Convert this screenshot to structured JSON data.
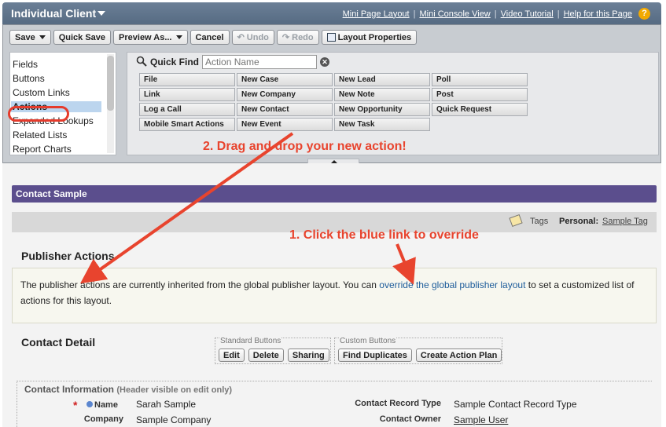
{
  "header": {
    "title": "Individual Client",
    "links": [
      "Mini Page Layout",
      "Mini Console View",
      "Video Tutorial",
      "Help for this Page"
    ]
  },
  "toolbar": {
    "save": "Save",
    "quick_save": "Quick Save",
    "preview_as": "Preview As...",
    "cancel": "Cancel",
    "undo": "Undo",
    "redo": "Redo",
    "layout_properties": "Layout Properties"
  },
  "palette": {
    "categories": [
      "Fields",
      "Buttons",
      "Custom Links",
      "Actions",
      "Expanded Lookups",
      "Related Lists",
      "Report Charts"
    ],
    "selected": "Actions",
    "quick_find_label": "Quick Find",
    "quick_find_placeholder": "Action Name",
    "actions": [
      [
        "File",
        "New Case",
        "New Lead",
        "Poll"
      ],
      [
        "Link",
        "New Company",
        "New Note",
        "Post"
      ],
      [
        "Log a Call",
        "New Contact",
        "New Opportunity",
        "Quick Request"
      ],
      [
        "Mobile Smart Actions",
        "New Event",
        "New Task"
      ]
    ]
  },
  "layout": {
    "section_title": "Contact Sample",
    "tags_label": "Tags",
    "personal_label": "Personal:",
    "sample_tag": "Sample Tag",
    "publisher_title": "Publisher Actions",
    "publisher_text_before": "The publisher actions are currently inherited from the global publisher layout. You can ",
    "publisher_link": "override the global publisher layout",
    "publisher_text_after": " to set a customized list of actions for this layout.",
    "detail_title": "Contact Detail",
    "standard_buttons_label": "Standard Buttons",
    "standard_buttons": [
      "Edit",
      "Delete",
      "Sharing"
    ],
    "custom_buttons_label": "Custom Buttons",
    "custom_buttons": [
      "Find Duplicates",
      "Create Action Plan"
    ],
    "contact_info_title": "Contact Information",
    "contact_info_sub": "(Header visible on edit only)",
    "fields": {
      "name_label": "Name",
      "name_value": "Sarah Sample",
      "company_label": "Company",
      "company_value": "Sample Company",
      "record_type_label": "Contact Record Type",
      "record_type_value": "Sample Contact Record Type",
      "owner_label": "Contact Owner",
      "owner_value": "Sample User"
    }
  },
  "annotations": {
    "step2": "2. Drag and drop your new action!",
    "step1": "1. Click the blue link to override"
  },
  "colors": {
    "header_bg": "#566b83",
    "section_header_bg": "#5b4e8d",
    "annotation_red": "#e8442e",
    "link_blue": "#1d5c9a"
  }
}
